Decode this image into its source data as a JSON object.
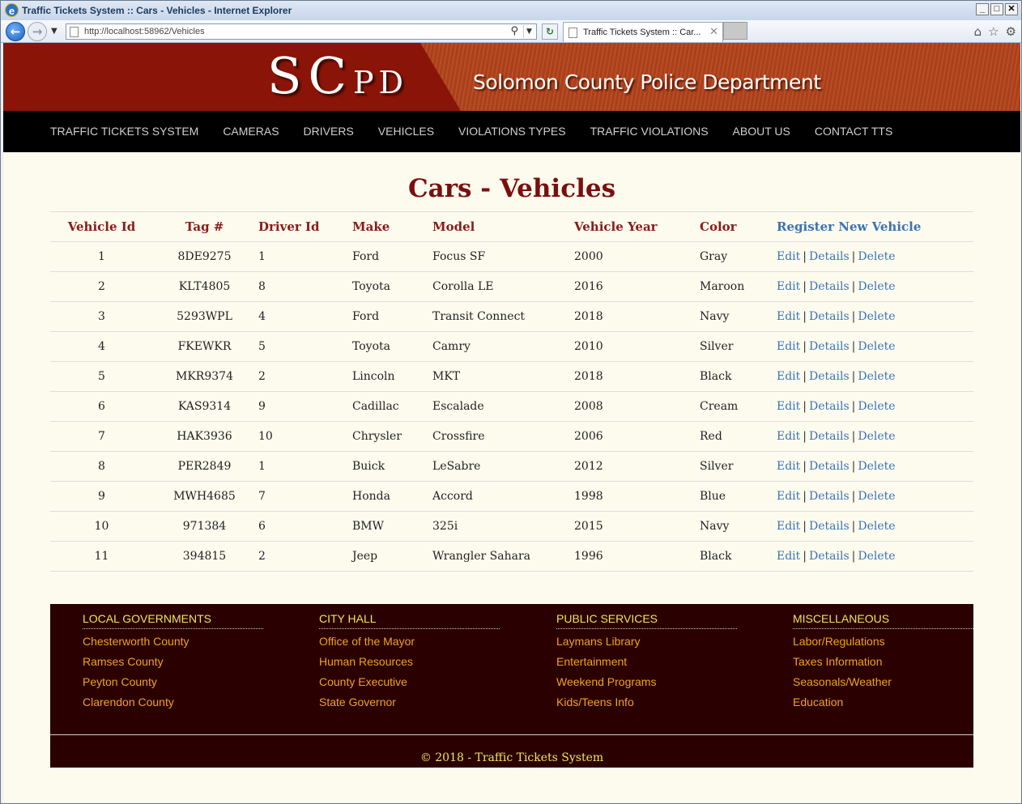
{
  "window": {
    "title": "Traffic Tickets System :: Cars - Vehicles - Internet Explorer"
  },
  "browser": {
    "url": "http://localhost:58962/Vehicles",
    "tab_title": "Traffic Tickets System :: Car...",
    "icons": [
      "back-arrow-icon",
      "forward-arrow-icon",
      "search-icon",
      "refresh-icon",
      "home-icon",
      "favorites-star-icon",
      "gear-icon"
    ]
  },
  "banner": {
    "logo_first": "S",
    "logo_second": "C",
    "logo_rest": "PD",
    "department": "Solomon County Police Department"
  },
  "menu": [
    "TRAFFIC TICKETS SYSTEM",
    "CAMERAS",
    "DRIVERS",
    "VEHICLES",
    "VIOLATIONS TYPES",
    "TRAFFIC VIOLATIONS",
    "ABOUT US",
    "CONTACT TTS"
  ],
  "main": {
    "title": "Cars - Vehicles",
    "columns": [
      "Vehicle Id",
      "Tag #",
      "Driver Id",
      "Make",
      "Model",
      "Vehicle Year",
      "Color"
    ],
    "register_link": "Register New Vehicle",
    "actions": {
      "edit": "Edit",
      "details": "Details",
      "delete": "Delete",
      "separator": "|"
    },
    "rows": [
      [
        "1",
        "8DE9275",
        "1",
        "Ford",
        "Focus SF",
        "2000",
        "Gray"
      ],
      [
        "2",
        "KLT4805",
        "8",
        "Toyota",
        "Corolla LE",
        "2016",
        "Maroon"
      ],
      [
        "3",
        "5293WPL",
        "4",
        "Ford",
        "Transit Connect",
        "2018",
        "Navy"
      ],
      [
        "4",
        "FKEWKR",
        "5",
        "Toyota",
        "Camry",
        "2010",
        "Silver"
      ],
      [
        "5",
        "MKR9374",
        "2",
        "Lincoln",
        "MKT",
        "2018",
        "Black"
      ],
      [
        "6",
        "KAS9314",
        "9",
        "Cadillac",
        "Escalade",
        "2008",
        "Cream"
      ],
      [
        "7",
        "HAK3936",
        "10",
        "Chrysler",
        "Crossfire",
        "2006",
        "Red"
      ],
      [
        "8",
        "PER2849",
        "1",
        "Buick",
        "LeSabre",
        "2012",
        "Silver"
      ],
      [
        "9",
        "MWH4685",
        "7",
        "Honda",
        "Accord",
        "1998",
        "Blue"
      ],
      [
        "10",
        "971384",
        "6",
        "BMW",
        "325i",
        "2015",
        "Navy"
      ],
      [
        "11",
        "394815",
        "2",
        "Jeep",
        "Wrangler Sahara",
        "1996",
        "Black"
      ]
    ]
  },
  "footer": {
    "columns": [
      {
        "title": "LOCAL GOVERNMENTS",
        "links": [
          "Chesterworth County",
          "Ramses County",
          "Peyton County",
          "Clarendon County"
        ]
      },
      {
        "title": "CITY HALL",
        "links": [
          "Office of the Mayor",
          "Human Resources",
          "County Executive",
          "State Governor"
        ]
      },
      {
        "title": "PUBLIC SERVICES",
        "links": [
          "Laymans Library",
          "Entertainment",
          "Weekend Programs",
          "Kids/Teens Info"
        ]
      },
      {
        "title": "MISCELLANEOUS",
        "links": [
          "Labor/Regulations",
          "Taxes Information",
          "Seasonals/Weather",
          "Education"
        ]
      }
    ],
    "copyright": "© 2018 - Traffic Tickets System"
  },
  "colors": {
    "banner_dark": "#8a1407",
    "banner_light": "#b4441c",
    "heading": "#7a0f0f",
    "link": "#3a73b5",
    "footer_bg": "#2a0000",
    "footer_title": "#f2e45c",
    "footer_link": "#f0a321"
  }
}
